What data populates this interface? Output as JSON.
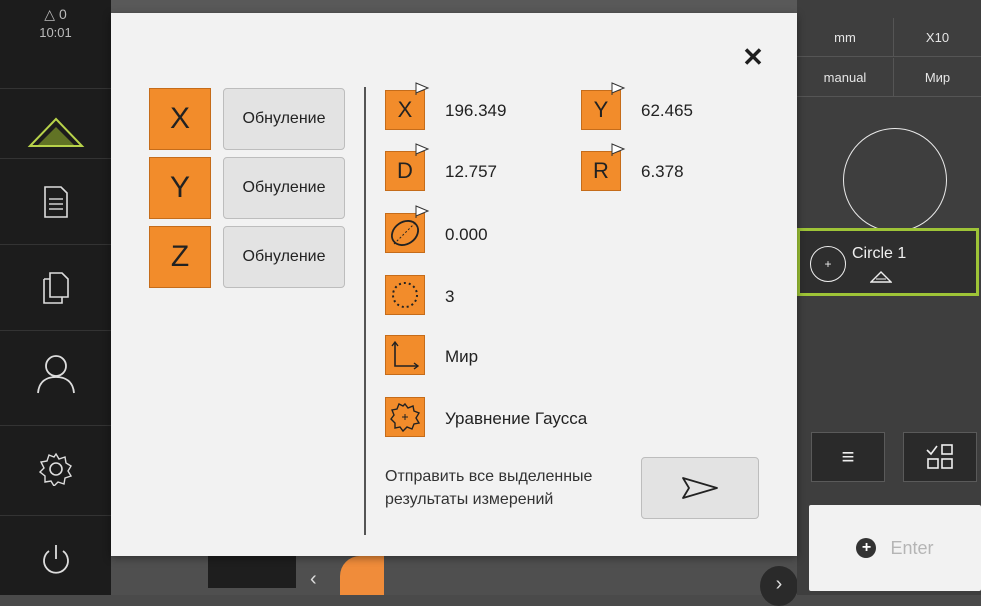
{
  "sidebar": {
    "message_count": "0",
    "time": "10:01",
    "items": [
      {
        "name": "measure-icon"
      },
      {
        "name": "protocol-icon"
      },
      {
        "name": "file-management-icon"
      },
      {
        "name": "user-icon"
      },
      {
        "name": "settings-icon"
      },
      {
        "name": "power-icon"
      }
    ]
  },
  "right_panel": {
    "unit": "mm",
    "zoom": "X10",
    "mode": "manual",
    "coord_system": "Мир",
    "feature_name": "Circle 1",
    "enter_label": "Enter"
  },
  "dialog": {
    "axes": [
      {
        "label": "X",
        "button": "Обнуление"
      },
      {
        "label": "Y",
        "button": "Обнуление"
      },
      {
        "label": "Z",
        "button": "Обнуление"
      }
    ],
    "results": {
      "x_label": "X",
      "x_value": "196.349",
      "y_label": "Y",
      "y_value": "62.465",
      "d_label": "D",
      "d_value": "12.757",
      "r_label": "R",
      "r_value": "6.378",
      "roundness_value": "0.000",
      "points_value": "3",
      "coord_system_value": "Мир",
      "fit_method_value": "Уравнение Гаусса"
    },
    "send_label": "Отправить все выделенные результаты измерений"
  },
  "colors": {
    "accent_orange": "#f28c2b",
    "feature_border_green": "#9ec437"
  }
}
